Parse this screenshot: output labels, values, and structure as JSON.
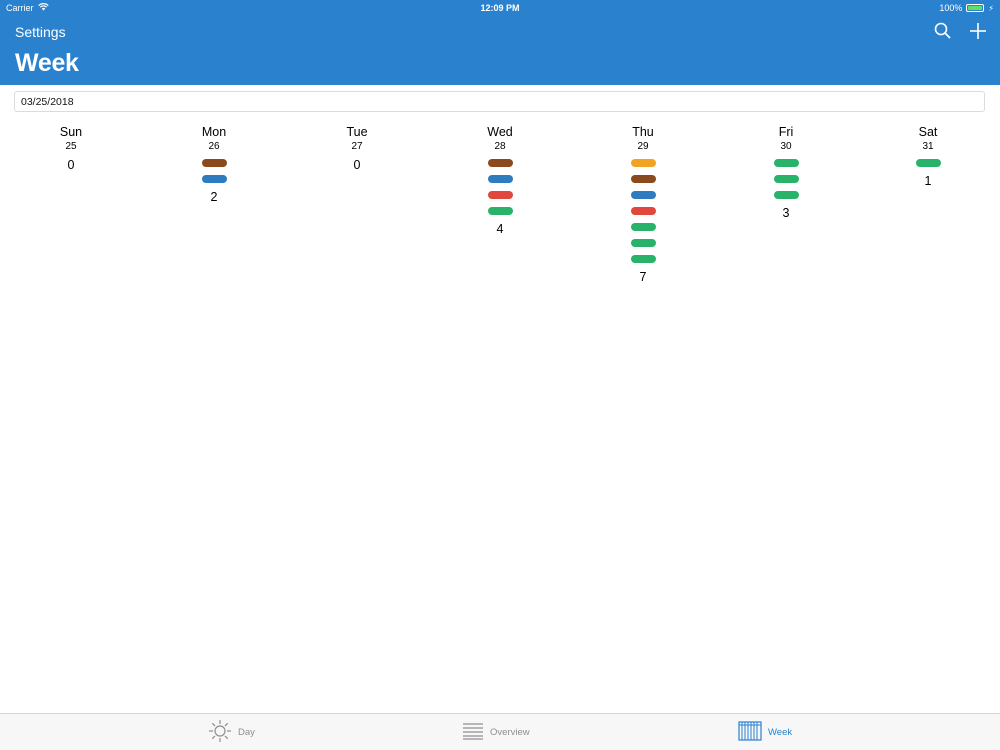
{
  "status_bar": {
    "carrier": "Carrier",
    "time": "12:09 PM",
    "battery": "100%",
    "battery_level": 1.0
  },
  "nav": {
    "back_label": "Settings",
    "title": "Week"
  },
  "date_field": {
    "value": "03/25/2018"
  },
  "colors": {
    "brand": "#2a82cf",
    "brown": "#8b4a1e",
    "blue": "#2e7bbf",
    "red": "#e2473e",
    "green": "#29b36a",
    "orange": "#f3a322"
  },
  "week": [
    {
      "name": "Sun",
      "date": "25",
      "bars": [],
      "count": "0"
    },
    {
      "name": "Mon",
      "date": "26",
      "bars": [
        "brown",
        "blue"
      ],
      "count": "2"
    },
    {
      "name": "Tue",
      "date": "27",
      "bars": [],
      "count": "0"
    },
    {
      "name": "Wed",
      "date": "28",
      "bars": [
        "brown",
        "blue",
        "red",
        "green"
      ],
      "count": "4"
    },
    {
      "name": "Thu",
      "date": "29",
      "bars": [
        "orange",
        "brown",
        "blue",
        "red",
        "green",
        "green",
        "green"
      ],
      "count": "7"
    },
    {
      "name": "Fri",
      "date": "30",
      "bars": [
        "green",
        "green",
        "green"
      ],
      "count": "3"
    },
    {
      "name": "Sat",
      "date": "31",
      "bars": [
        "green"
      ],
      "count": "1"
    }
  ],
  "tabs": [
    {
      "label": "Day",
      "icon": "sun-icon",
      "active": false
    },
    {
      "label": "Overview",
      "icon": "list-icon",
      "active": false
    },
    {
      "label": "Week",
      "icon": "calendar-grid-icon",
      "active": true
    }
  ]
}
